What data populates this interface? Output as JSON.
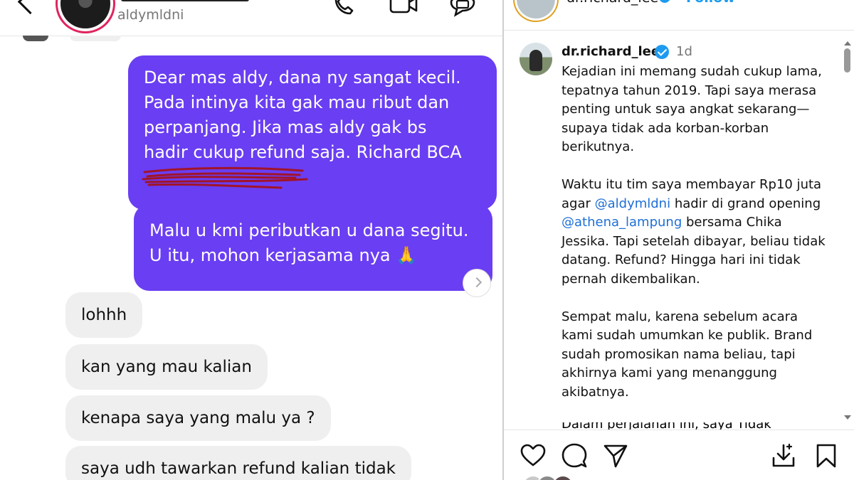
{
  "dm": {
    "username": "aldymldni",
    "messages_out": [
      {
        "text": "Dear mas aldy, dana ny sangat kecil.\nPada intinya kita gak mau ribut dan\nperpanjang. Jika mas aldy gak bs\nhadir cukup refund saja. Richard BCA"
      },
      {
        "text": "Malu u kmi peributkan u dana segitu.\nU itu, mohon kerjasama nya 🙏"
      }
    ],
    "messages_in": [
      {
        "text": "lohhh"
      },
      {
        "text": "kan yang mau kalian"
      },
      {
        "text": "kenapa saya yang malu ya ?"
      },
      {
        "text": "saya udh tawarkan refund kalian tidak"
      }
    ]
  },
  "post": {
    "header": {
      "username": "dr.richard_lee",
      "follow_label": "Follow",
      "more": "···"
    },
    "caption": {
      "username": "dr.richard_lee",
      "time": "1d",
      "p1": "Kejadian ini memang sudah cukup lama, tepatnya tahun 2019. Tapi saya merasa penting untuk saya angkat sekarang—supaya tidak ada korban-korban berikutnya.",
      "p2_a": "Waktu itu tim saya membayar Rp10 juta agar ",
      "p2_mention1": "@aldymldni",
      "p2_b": " hadir di grand opening ",
      "p2_mention2": "@athena_lampung",
      "p2_c": " bersama Chika Jessika. Tapi setelah dibayar, beliau tidak datang. Refund? Hingga hari ini tidak pernah dikembalikan.",
      "p3": "Sempat malu, karena sebelum acara kami sudah umumkan ke publik. Brand sudah promosikan nama beliau, tapi akhirnya kami yang menanggung akibatnya.",
      "p4_clipped": "Dalam perjalanan ini, saya Tidak"
    }
  },
  "colors": {
    "bubble_out": "#6a3ef2",
    "bubble_in": "#efefef",
    "mention": "#1d6fd6",
    "verified": "#1d9bf0"
  }
}
